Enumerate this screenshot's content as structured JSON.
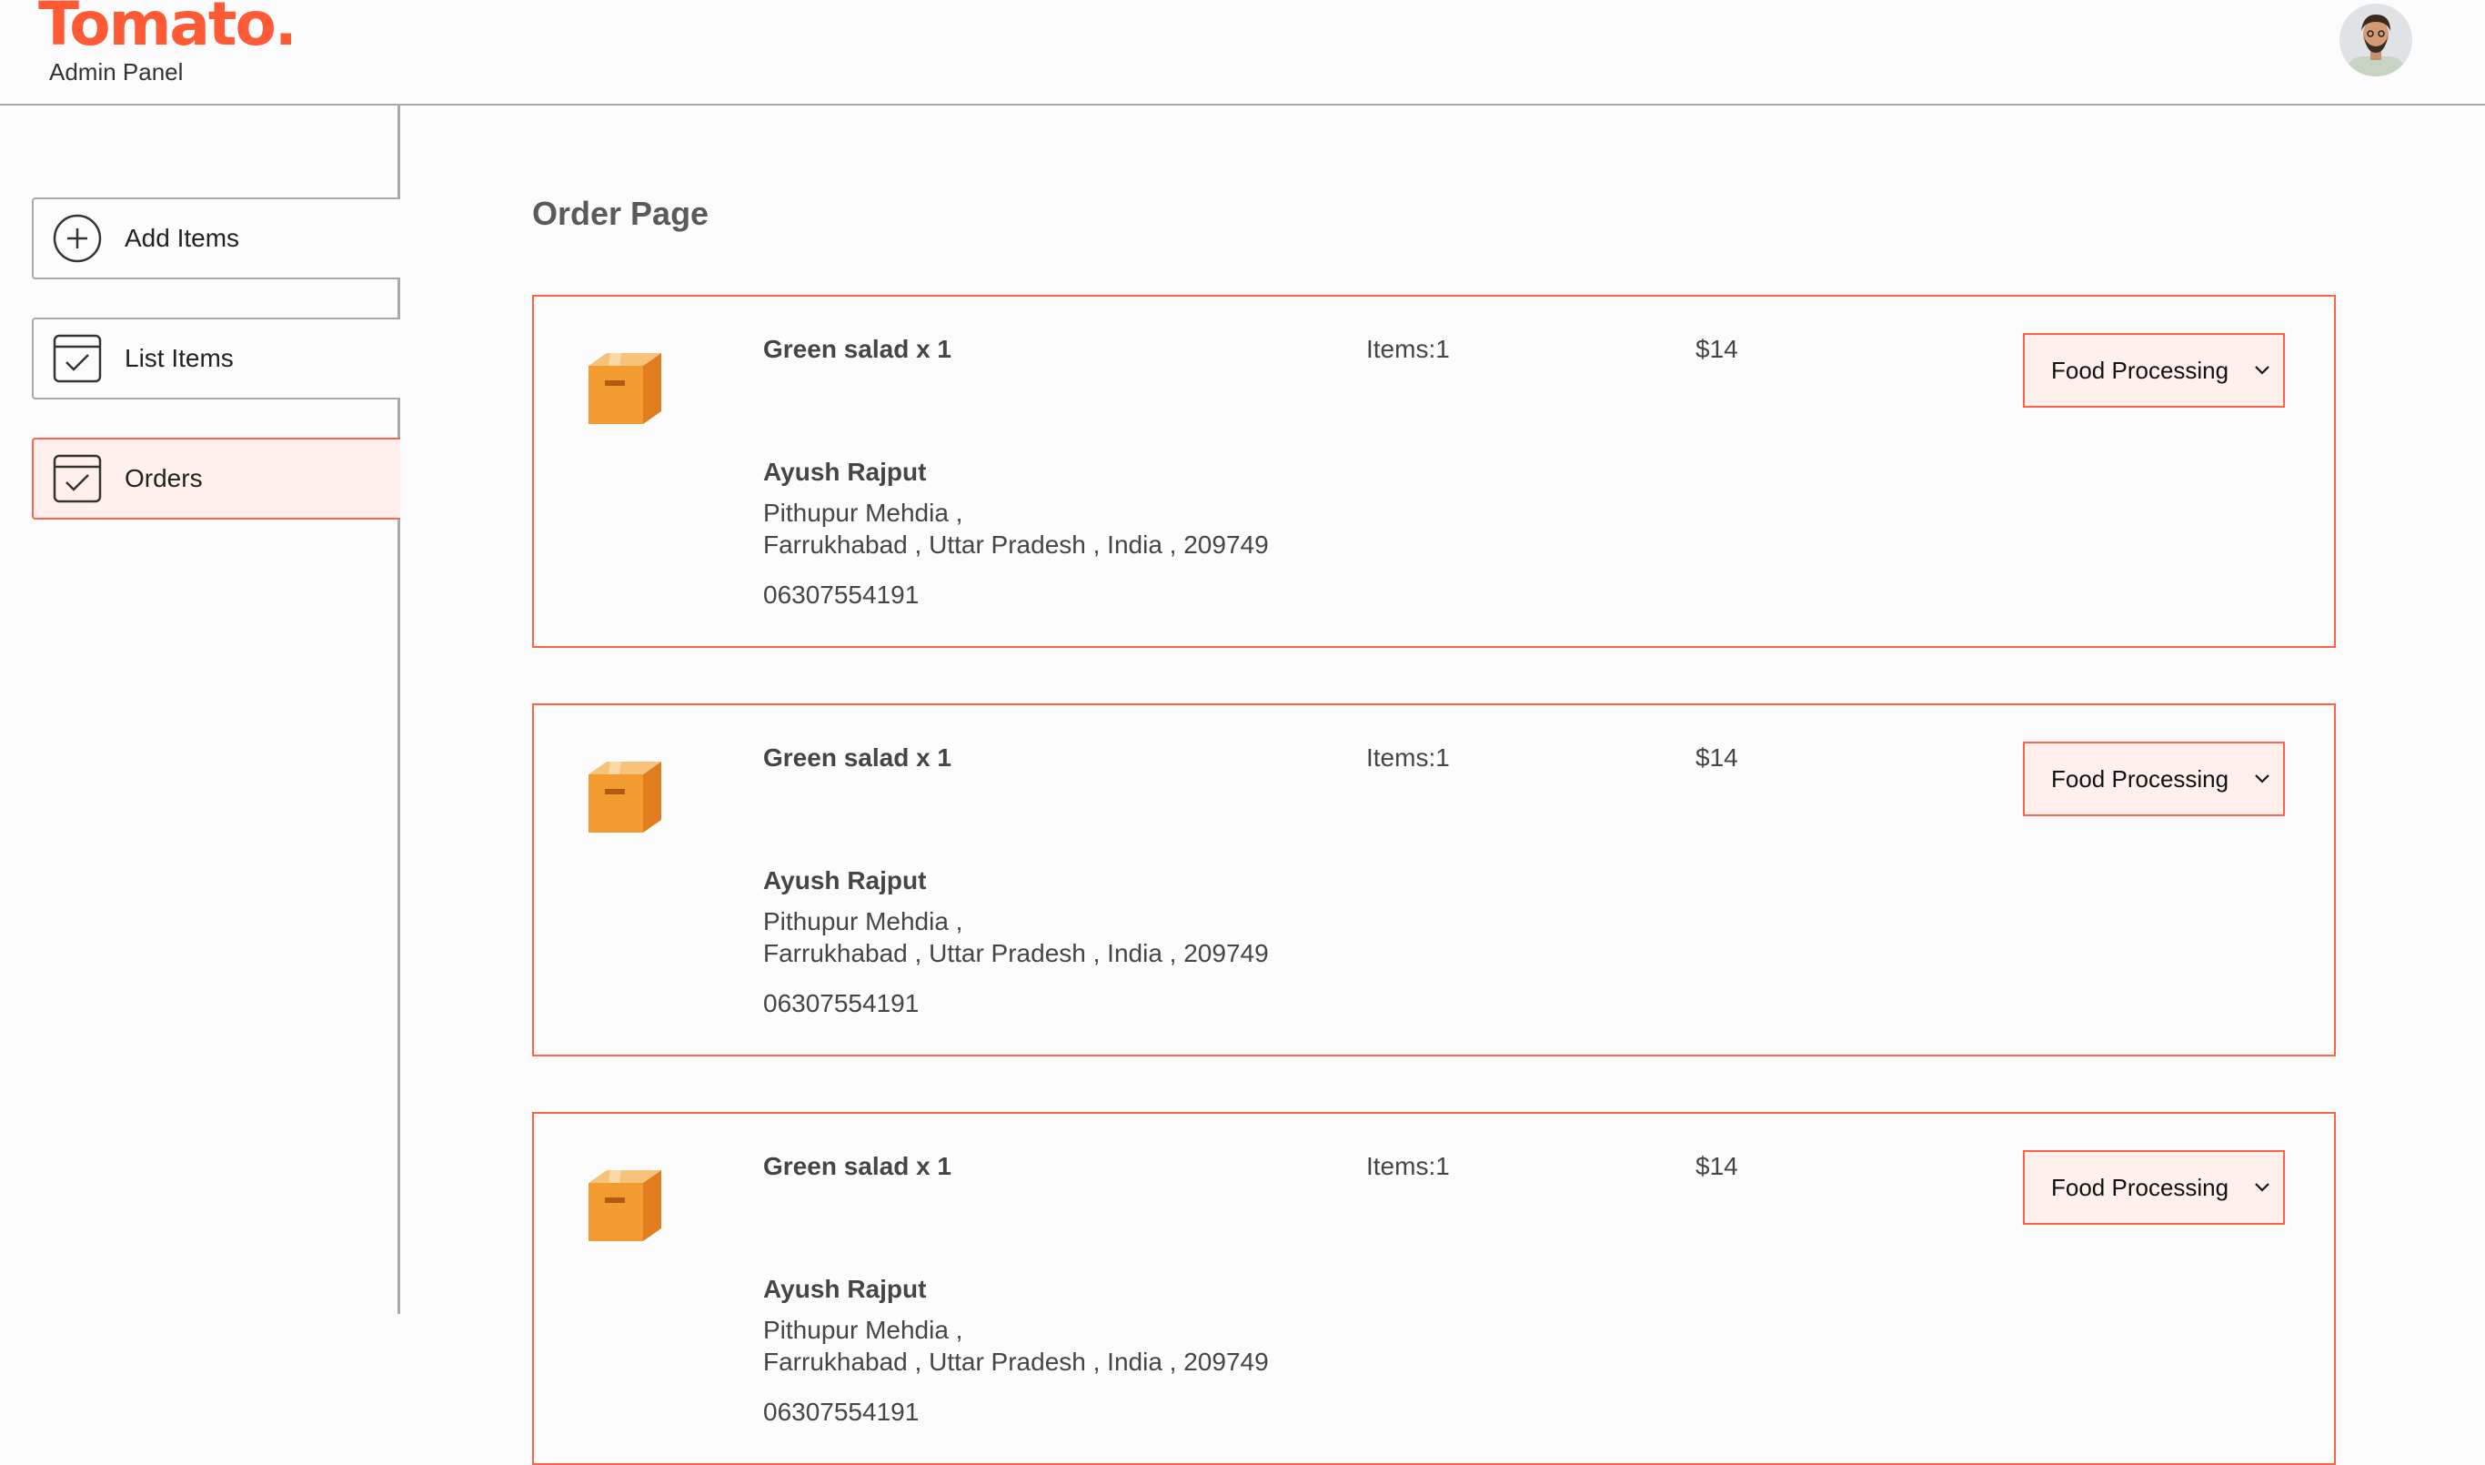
{
  "header": {
    "logo": "Tomato.",
    "subtitle": "Admin Panel",
    "avatar_icon": "user-avatar"
  },
  "sidebar": {
    "items": [
      {
        "label": "Add Items",
        "icon": "add-circle-icon",
        "active": false
      },
      {
        "label": "List Items",
        "icon": "checklist-icon",
        "active": false
      },
      {
        "label": "Orders",
        "icon": "checklist-icon",
        "active": true
      }
    ]
  },
  "main": {
    "title": "Order Page",
    "orders": [
      {
        "items_text": "Green salad x 1",
        "count_text": "Items:1",
        "amount": "$14",
        "status": "Food Processing",
        "customer_name": "Ayush Rajput",
        "address_line1": "Pithupur Mehdia ,",
        "address_line2": "Farrukhabad , Uttar Pradesh , India , 209749",
        "phone": "06307554191"
      },
      {
        "items_text": "Green salad x 1",
        "count_text": "Items:1",
        "amount": "$14",
        "status": "Food Processing",
        "customer_name": "Ayush Rajput",
        "address_line1": "Pithupur Mehdia ,",
        "address_line2": "Farrukhabad , Uttar Pradesh , India , 209749",
        "phone": "06307554191"
      },
      {
        "items_text": "Green salad x 1",
        "count_text": "Items:1",
        "amount": "$14",
        "status": "Food Processing",
        "customer_name": "Ayush Rajput",
        "address_line1": "Pithupur Mehdia ,",
        "address_line2": "Farrukhabad , Uttar Pradesh , India , 209749",
        "phone": "06307554191"
      }
    ]
  },
  "colors": {
    "brand": "#ff5a36",
    "accent": "#ff6347",
    "active_bg": "#fff0ed",
    "parcel_orange": "#f29b30"
  }
}
